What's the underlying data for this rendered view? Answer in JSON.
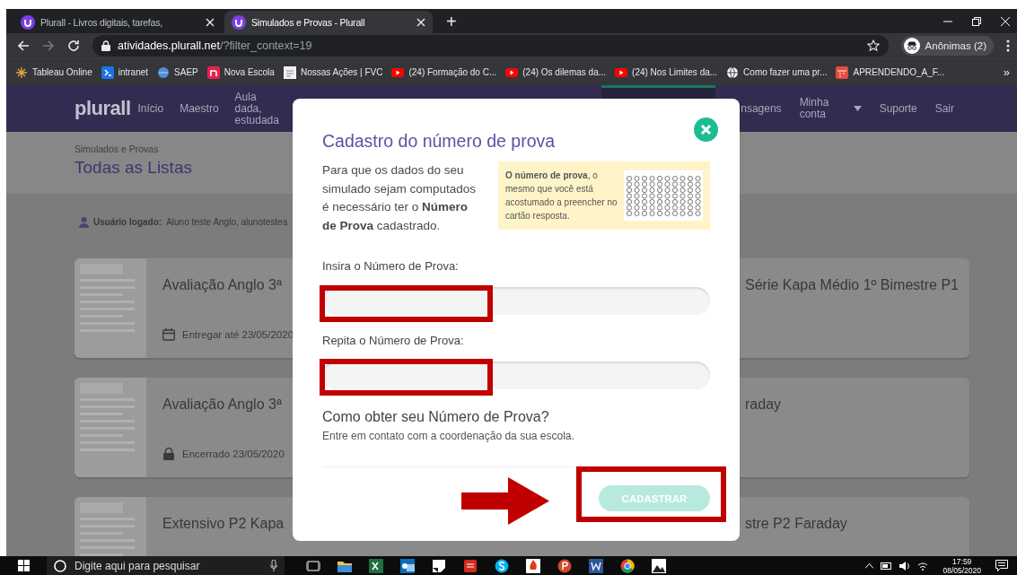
{
  "browser": {
    "tabs": [
      {
        "title": "Plurall - Livros digitais, tarefas,",
        "selected": false
      },
      {
        "title": "Simulados e Provas - Plurall",
        "selected": true
      }
    ],
    "new_tab": "+",
    "address": {
      "host": "atividades.plurall.net",
      "path": "/?filter_context=19"
    },
    "profile": "Anônimas (2)",
    "bookmarks": [
      {
        "label": "Tableau Online",
        "kind": "tableau"
      },
      {
        "label": "intranet",
        "kind": "sap"
      },
      {
        "label": "SAEP",
        "kind": "globe"
      },
      {
        "label": "Nova Escola",
        "kind": "letter"
      },
      {
        "label": "Nossas Ações | FVC",
        "kind": "page"
      },
      {
        "label": "(24) Formação do C...",
        "kind": "video"
      },
      {
        "label": "(24) Os dilemas da...",
        "kind": "video"
      },
      {
        "label": "(24) Nos Limites da...",
        "kind": "video"
      },
      {
        "label": "Como fazer uma pr...",
        "kind": "web"
      },
      {
        "label": "APRENDENDO_A_F...",
        "kind": "calendar"
      }
    ],
    "bookmarks_more": "»"
  },
  "page": {
    "logo": "plurall",
    "nav_left": [
      "Início",
      "Maestro",
      "Aula dada, estudada"
    ],
    "nav_right": [
      {
        "label": "nsagens",
        "kind": "link"
      },
      {
        "label": "Minha conta",
        "kind": "dropdown"
      },
      {
        "label": "Suporte",
        "kind": "link"
      },
      {
        "label": "Sair",
        "kind": "link"
      }
    ],
    "breadcrumb": "Simulados e Provas",
    "heading": "Todas as Listas",
    "user": {
      "label": "Usuário logado:",
      "value": "Aluno teste Anglo, alunotestea"
    },
    "cards": [
      {
        "title": "Avaliação Anglo 3ª",
        "kind": "due",
        "date": "Entregar até 23/05/2020",
        "title_right": "Série Kapa Médio 1º Bimestre P1"
      },
      {
        "title": "Avaliação Anglo 3ª",
        "kind": "closed",
        "date": "Encerrado 23/05/2020",
        "title_right": "raday"
      },
      {
        "title": "Extensivo P2 Kapa",
        "title_right": "stre P2 Faraday"
      }
    ]
  },
  "modal": {
    "title": "Cadastro do número de prova",
    "intro": "Para que os dados do seu simulado sejam computados é necessário ter o **Número de Prova** cadastrado.",
    "info": "**O número de prova**, o mesmo que você está acostumado a preencher no cartão resposta.",
    "fields": [
      {
        "label": "Insira o Número de Prova:"
      },
      {
        "label": "Repita o Número de Prova:"
      }
    ],
    "help_title": "Como obter seu Número de Prova?",
    "help_text": "Entre em contato com a coordenação da sua escola.",
    "submit": {
      "label": "CADASTRAR",
      "disabled": true
    }
  },
  "taskbar": {
    "search_placeholder": "Digite aqui para pesquisar",
    "time": "17:59",
    "date": "08/05/2020"
  }
}
